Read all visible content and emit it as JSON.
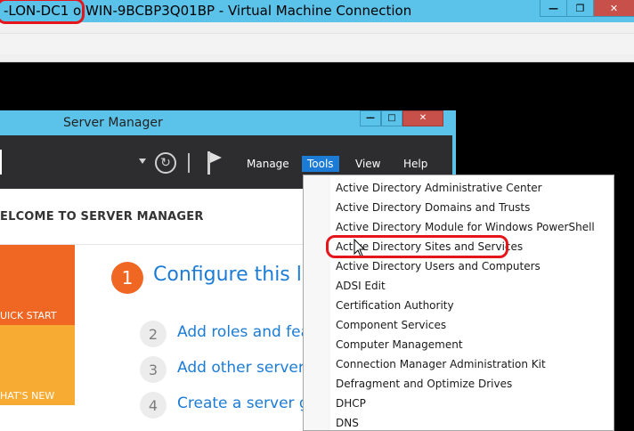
{
  "vm_window": {
    "title_left": "-LON-DC1",
    "title_on": "o",
    "title_right": "WIN-9BCBP3Q01BP - Virtual Machine Connection",
    "buttons": [
      "minimize",
      "restore",
      "close"
    ]
  },
  "server_manager": {
    "title": "Server Manager",
    "header": {
      "menus": {
        "manage": "Manage",
        "tools": "Tools",
        "view": "View",
        "help": "Help"
      }
    },
    "welcome": "ELCOME TO SERVER MANAGER",
    "tiles": {
      "quick_start": "UICK START",
      "whats_new": "HAT'S NEW"
    },
    "steps": [
      {
        "num": "1",
        "text": "Configure this loc"
      },
      {
        "num": "2",
        "text": "Add roles and feat"
      },
      {
        "num": "3",
        "text": "Add other servers"
      },
      {
        "num": "4",
        "text": "Create a server gr"
      }
    ]
  },
  "tools_menu": {
    "items": [
      "Active Directory Administrative Center",
      "Active Directory Domains and Trusts",
      "Active Directory Module for Windows PowerShell",
      "Active Directory Sites and Services",
      "Active Directory Users and Computers",
      "ADSI Edit",
      "Certification Authority",
      "Component Services",
      "Computer Management",
      "Connection Manager Administration Kit",
      "Defragment and Optimize Drives",
      "DHCP",
      "DNS"
    ],
    "highlighted_index": 3
  },
  "colors": {
    "title_bar": "#5bc3ea",
    "close_button": "#c7504b",
    "accent_blue": "#1c7cd5",
    "orange": "#f06623",
    "light_orange": "#f8ab32",
    "annotation_red": "#e5161b"
  }
}
